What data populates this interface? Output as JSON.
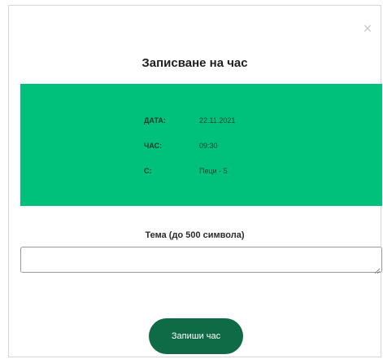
{
  "dialog": {
    "close_symbol": "×",
    "title": "Записване на час"
  },
  "appointment": {
    "colors": {
      "box_background": "#00c17b",
      "button_background": "#0f6b45"
    },
    "rows": [
      {
        "label": "ДАТА:",
        "value": "22.11.2021"
      },
      {
        "label": "ЧАС:",
        "value": "09:30"
      },
      {
        "label": "С:",
        "value": "Пеци - 5"
      }
    ]
  },
  "topic": {
    "label": "Тема (до 500 символа)",
    "value": "",
    "placeholder": ""
  },
  "actions": {
    "submit_label": "Запиши час"
  }
}
